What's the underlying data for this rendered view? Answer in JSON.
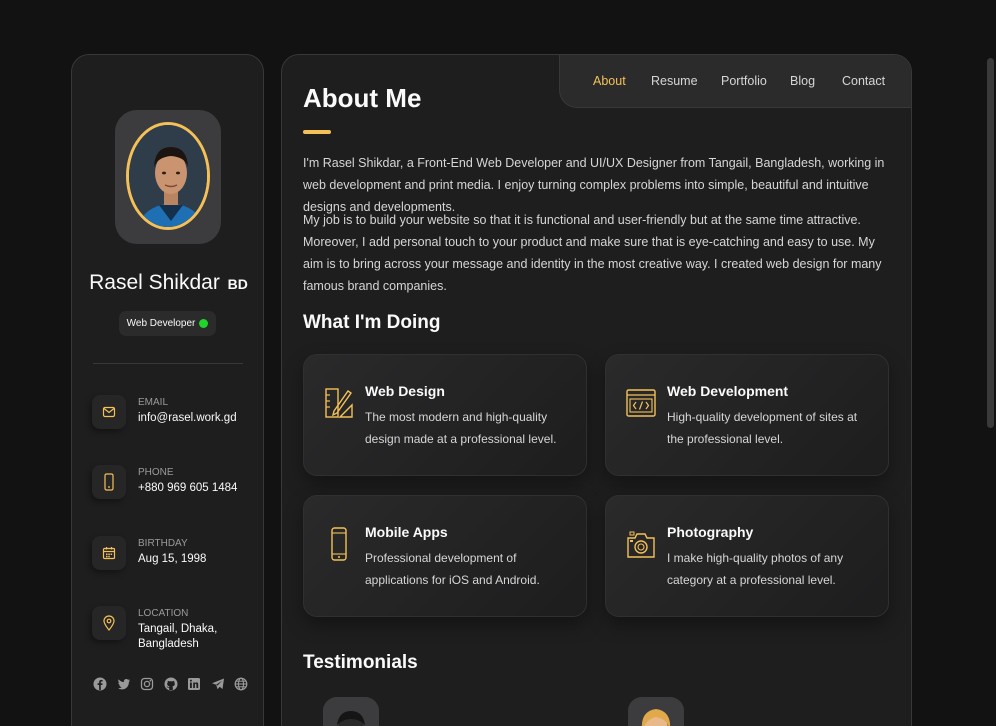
{
  "profile": {
    "name": "Rasel Shikdar",
    "name_suffix": "BD",
    "title": "Web Developer"
  },
  "contacts": [
    {
      "icon": "mail-icon",
      "label": "EMAIL",
      "value": "info@rasel.work.gd"
    },
    {
      "icon": "phone-icon",
      "label": "PHONE",
      "value": "+880 969 605 1484"
    },
    {
      "icon": "calendar-icon",
      "label": "BIRTHDAY",
      "value": "Aug 15, 1998"
    },
    {
      "icon": "location-icon",
      "label": "LOCATION",
      "value": "Tangail, Dhaka, Bangladesh"
    }
  ],
  "socials": [
    "facebook-icon",
    "twitter-icon",
    "instagram-icon",
    "github-icon",
    "linkedin-icon",
    "telegram-icon",
    "website-icon"
  ],
  "nav": {
    "items": [
      "About",
      "Resume",
      "Portfolio",
      "Blog",
      "Contact"
    ],
    "active": "About"
  },
  "about": {
    "title": "About Me",
    "paragraphs": [
      "I'm Rasel Shikdar, a Front-End Web Developer and UI/UX Designer from Tangail, Bangladesh, working in web development and print media. I enjoy turning complex problems into simple, beautiful and intuitive designs and developments.",
      "My job is to build your website so that it is functional and user-friendly but at the same time attractive. Moreover, I add personal touch to your product and make sure that is eye-catching and easy to use. My aim is to bring across your message and identity in the most creative way. I created web design for many famous brand companies."
    ]
  },
  "services": {
    "title": "What I'm Doing",
    "items": [
      {
        "icon": "design-icon",
        "title": "Web Design",
        "text": "The most modern and high-quality design made at a professional level."
      },
      {
        "icon": "code-icon",
        "title": "Web Development",
        "text": "High-quality development of sites at the professional level."
      },
      {
        "icon": "mobile-icon",
        "title": "Mobile Apps",
        "text": "Professional development of applications for iOS and Android."
      },
      {
        "icon": "camera-icon",
        "title": "Photography",
        "text": "I make high-quality photos of any category at a professional level."
      }
    ]
  },
  "testimonials": {
    "title": "Testimonials"
  },
  "colors": {
    "accent": "#f4c158",
    "background": "#121212",
    "card": "#1e1e1f",
    "status": "#1fd52a"
  }
}
